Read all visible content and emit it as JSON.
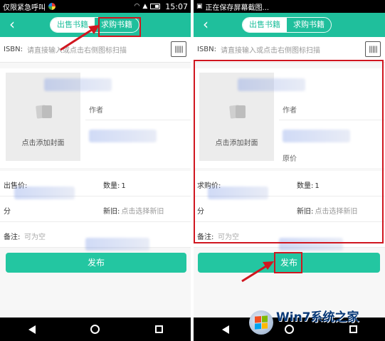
{
  "left": {
    "status": {
      "text": "仅限紧急呼叫",
      "time": "15:07"
    },
    "tabs": [
      "出售书籍",
      "求购书籍"
    ],
    "active_tab": 0,
    "isbn": {
      "label": "ISBN:",
      "placeholder": "请直接输入或点击右侧图标扫描"
    },
    "cover_label": "点击添加封面",
    "author_label": "作者",
    "form": {
      "price_label": "出售价:",
      "qty_label": "数量:",
      "qty_value": "1",
      "category_label": "分",
      "condition_label": "新旧:",
      "condition_placeholder": "点击选择新旧",
      "note_label": "备注:",
      "note_placeholder": "可为空"
    },
    "publish_label": "发布"
  },
  "right": {
    "status": {
      "text": "正在保存屏幕截图..."
    },
    "tabs": [
      "出售书籍",
      "求购书籍"
    ],
    "active_tab": 0,
    "isbn": {
      "label": "ISBN:",
      "placeholder": "请直接输入或点击右侧图标扫描"
    },
    "cover_label": "点击添加封面",
    "author_label": "作者",
    "extra_label": "原价",
    "form": {
      "price_label": "求购价:",
      "qty_label": "数量:",
      "qty_value": "1",
      "category_label": "分",
      "condition_label": "新旧:",
      "condition_placeholder": "点击选择新旧",
      "note_label": "备注:",
      "note_placeholder": "可为空"
    },
    "publish_label": "发布"
  },
  "watermark": {
    "site_text": "Win7系统之家"
  },
  "colors": {
    "accent": "#1fbf9c",
    "highlight": "#d0161f"
  }
}
